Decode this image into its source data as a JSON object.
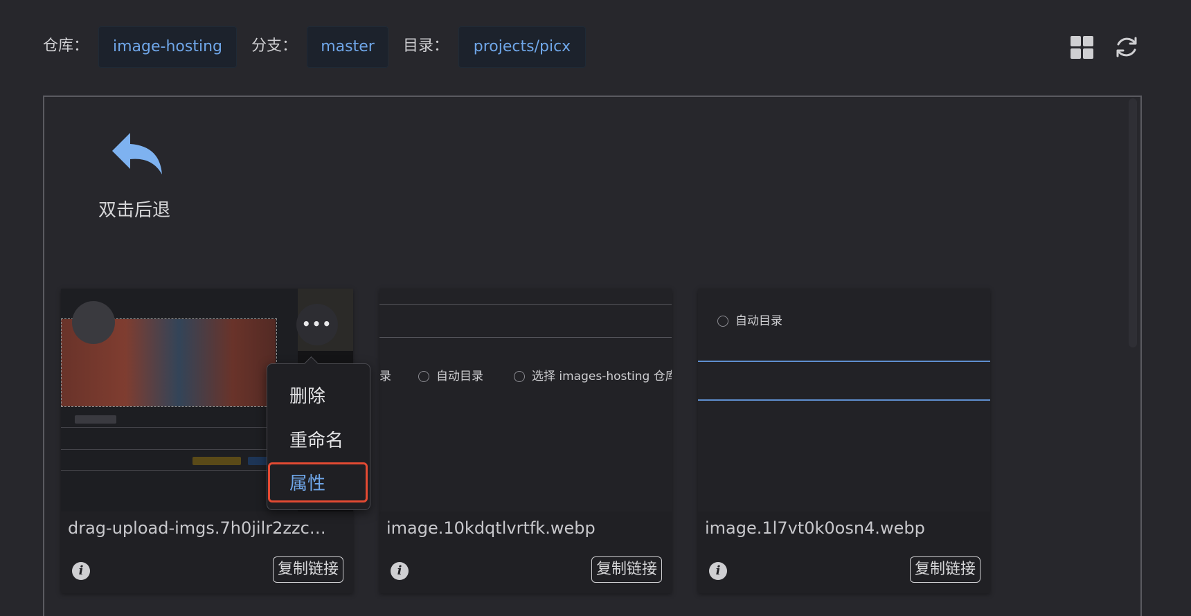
{
  "header": {
    "repo_label": "仓库：",
    "repo_value": "image-hosting",
    "branch_label": "分支：",
    "branch_value": "master",
    "dir_label": "目录：",
    "dir_value": "projects/picx"
  },
  "toolbar_icons": [
    "grid-view-icon",
    "refresh-icon"
  ],
  "back": {
    "label": "双击后退"
  },
  "cards": [
    {
      "filename": "drag-upload-imgs.7h0jilr2zzc…",
      "copy_label": "复制链接"
    },
    {
      "filename": "image.10kdqtlvrtfk.webp",
      "copy_label": "复制链接",
      "thumb_texts": [
        "录",
        "自动目录",
        "选择 images-hosting 仓库"
      ]
    },
    {
      "filename": "image.1l7vt0k0osn4.webp",
      "copy_label": "复制链接",
      "thumb_texts": [
        "自动目录"
      ]
    }
  ],
  "context_menu": {
    "items": [
      "删除",
      "重命名",
      "属性"
    ],
    "highlighted": "属性"
  },
  "colors": {
    "accent": "#6fa6e8",
    "highlight": "#e34a33",
    "background": "#27272c"
  }
}
